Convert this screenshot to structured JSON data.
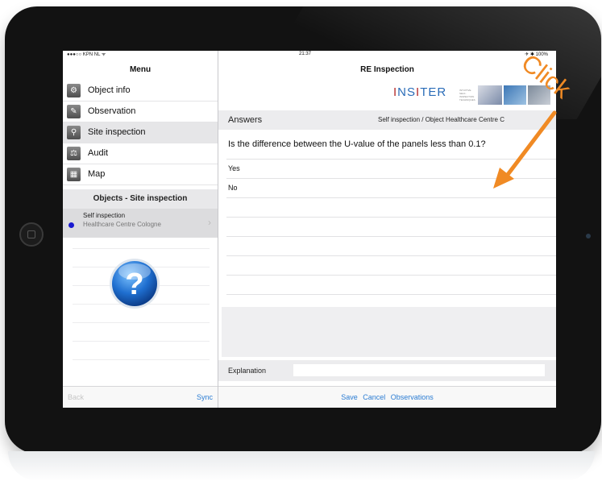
{
  "status": {
    "carrier": "●●●○○ KPN NL ᯤ",
    "time": "21:37",
    "battery": "✈ ✱ 100%"
  },
  "menu": {
    "title": "Menu",
    "items": [
      {
        "label": "Object info",
        "icon": "object-info-icon",
        "glyph": "⚙"
      },
      {
        "label": "Observation",
        "icon": "pencil-icon",
        "glyph": "✎"
      },
      {
        "label": "Site inspection",
        "icon": "magnifier-icon",
        "glyph": "⚲"
      },
      {
        "label": "Audit",
        "icon": "stamp-icon",
        "glyph": "⚖"
      },
      {
        "label": "Map",
        "icon": "map-icon",
        "glyph": "▦"
      }
    ]
  },
  "objects": {
    "title": "Objects - Site inspection",
    "item": {
      "title": "Self inspection",
      "subtitle": "Healthcare Centre Cologne"
    }
  },
  "left_footer": {
    "back": "Back",
    "sync": "Sync"
  },
  "right": {
    "title": "RE Inspection",
    "logo_text": "INSITER",
    "logo_tagline": "INTUITIVE SELF-INSPECTION TECHNIQUES",
    "answers_label": "Answers",
    "breadcrumb": "Self inspection / Object Healthcare Centre C",
    "question": "Is the difference between the U-value of the panels less than 0.1?",
    "options": [
      "Yes",
      "No"
    ],
    "explanation_label": "Explanation",
    "explanation_value": "",
    "footer": {
      "save": "Save",
      "cancel": "Cancel",
      "observations": "Observations"
    }
  },
  "annotation": {
    "text": "Click",
    "color": "#f08a24"
  },
  "colors": {
    "accent": "#2b7cd3",
    "selected_row": "#e6e6e8",
    "dot": "#1a1ad0"
  }
}
